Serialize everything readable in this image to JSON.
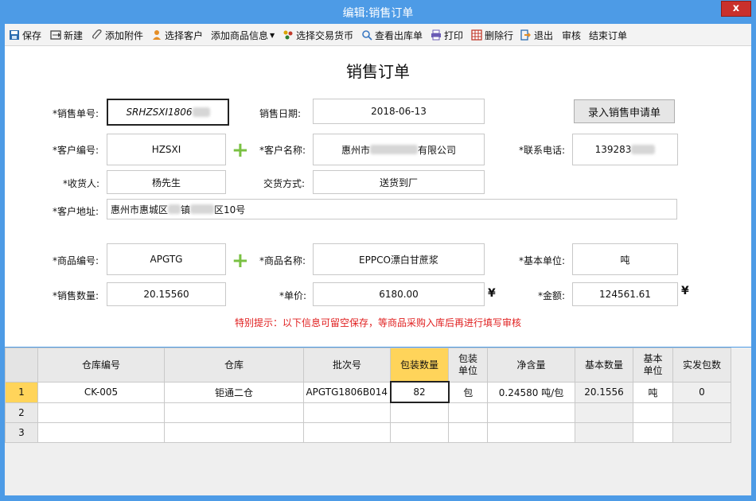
{
  "window": {
    "title": "编辑:销售订单",
    "close_label": "x"
  },
  "toolbar": {
    "items": [
      {
        "label": "保存",
        "icon": "save-icon"
      },
      {
        "label": "新建",
        "icon": "new-icon"
      },
      {
        "label": "添加附件",
        "icon": "paperclip-icon"
      },
      {
        "label": "选择客户",
        "icon": "person-icon"
      },
      {
        "label": "添加商品信息",
        "icon": "dropdown-icon"
      },
      {
        "label": "选择交易货币",
        "icon": "currency-icon"
      },
      {
        "label": "查看出库单",
        "icon": "search-icon"
      },
      {
        "label": "打印",
        "icon": "printer-icon"
      },
      {
        "label": "删除行",
        "icon": "delete-row-icon"
      },
      {
        "label": "退出",
        "icon": "exit-icon"
      },
      {
        "label": "审核",
        "icon": ""
      },
      {
        "label": "结束订单",
        "icon": ""
      }
    ]
  },
  "form": {
    "title": "销售订单",
    "import_button": "录入销售申请单",
    "order_no": {
      "label": "*销售单号:",
      "value": "SRHZSXI1806"
    },
    "sale_date": {
      "label": "销售日期:",
      "value": "2018-06-13"
    },
    "customer_code": {
      "label": "*客户编号:",
      "value": "HZSXI"
    },
    "customer_name": {
      "label": "*客户名称:",
      "value_prefix": "惠州市",
      "value_suffix": "有限公司"
    },
    "phone": {
      "label": "*联系电话:",
      "value": "139283"
    },
    "receiver": {
      "label": "*收货人:",
      "value": "杨先生"
    },
    "delivery": {
      "label": "交货方式:",
      "value": "送货到厂"
    },
    "address": {
      "label": "*客户地址:",
      "value_a": "惠州市惠城区",
      "value_b": "镇",
      "value_c": "区10号"
    },
    "product_code": {
      "label": "*商品编号:",
      "value": "APGTG"
    },
    "product_name": {
      "label": "*商品名称:",
      "value": "EPPCO漂白甘蔗浆"
    },
    "base_unit": {
      "label": "*基本单位:",
      "value": "吨"
    },
    "quantity": {
      "label": "*销售数量:",
      "value": "20.15560"
    },
    "unit_price": {
      "label": "*单价:",
      "value": "6180.00"
    },
    "amount": {
      "label": "*金额:",
      "value": "124561.61"
    },
    "currency_symbol": "¥",
    "hint": "特别提示：以下信息可留空保存，等商品采购入库后再进行填写审核"
  },
  "grid": {
    "columns": [
      "",
      "仓库编号",
      "仓库",
      "批次号",
      "包装数量",
      "包装\n单位",
      "净含量",
      "基本数量",
      "基本\n单位",
      "实发包数"
    ],
    "rows": [
      {
        "n": "1",
        "wh_code": "CK-005",
        "wh": "钜通二仓",
        "batch": "APGTG1806B014",
        "pack_qty": "82",
        "pack_unit": "包",
        "net": "0.24580  吨/包",
        "base_qty": "20.1556",
        "base_unit": "吨",
        "shipped": "0"
      },
      {
        "n": "2",
        "wh_code": "",
        "wh": "",
        "batch": "",
        "pack_qty": "",
        "pack_unit": "",
        "net": "",
        "base_qty": "",
        "base_unit": "",
        "shipped": ""
      },
      {
        "n": "3",
        "wh_code": "",
        "wh": "",
        "batch": "",
        "pack_qty": "",
        "pack_unit": "",
        "net": "",
        "base_qty": "",
        "base_unit": "",
        "shipped": ""
      }
    ]
  },
  "colors": {
    "titlebar": "#4d9be6",
    "highlight": "#ffd45a",
    "hint": "#e02020",
    "plus": "#7ac143"
  }
}
